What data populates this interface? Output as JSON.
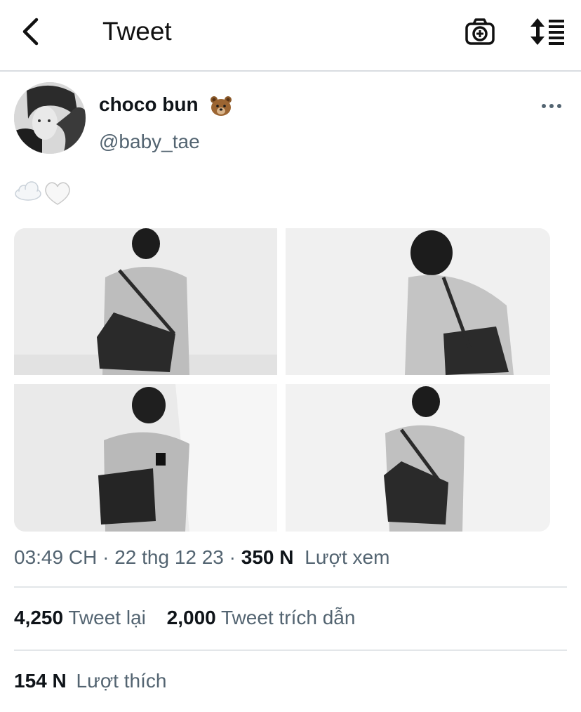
{
  "header": {
    "title": "Tweet",
    "back_icon": "chevron-left-icon",
    "camera_icon": "camera-plus-icon",
    "sort_icon": "sort-list-icon"
  },
  "author": {
    "display_name": "choco bun",
    "name_emoji": "bear-face-emoji",
    "handle": "@baby_tae"
  },
  "tweet": {
    "emojis": [
      "cloud-emoji",
      "white-heart-emoji"
    ],
    "images": [
      "celine-jacket-back-view",
      "celine-jacket-side-view",
      "celine-jacket-front-view",
      "celine-jacket-back-view-2"
    ]
  },
  "meta": {
    "time": "03:49 CH",
    "date": "22 thg 12 23",
    "views_count": "350 N",
    "views_label": "Lượt xem"
  },
  "stats": {
    "retweets_count": "4,250",
    "retweets_label": "Tweet lại",
    "quotes_count": "2,000",
    "quotes_label": "Tweet trích dẫn",
    "likes_count": "154 N",
    "likes_label": "Lượt thích"
  },
  "colors": {
    "text_primary": "#0f1419",
    "text_secondary": "#536471",
    "divider": "#e3e6e9"
  }
}
